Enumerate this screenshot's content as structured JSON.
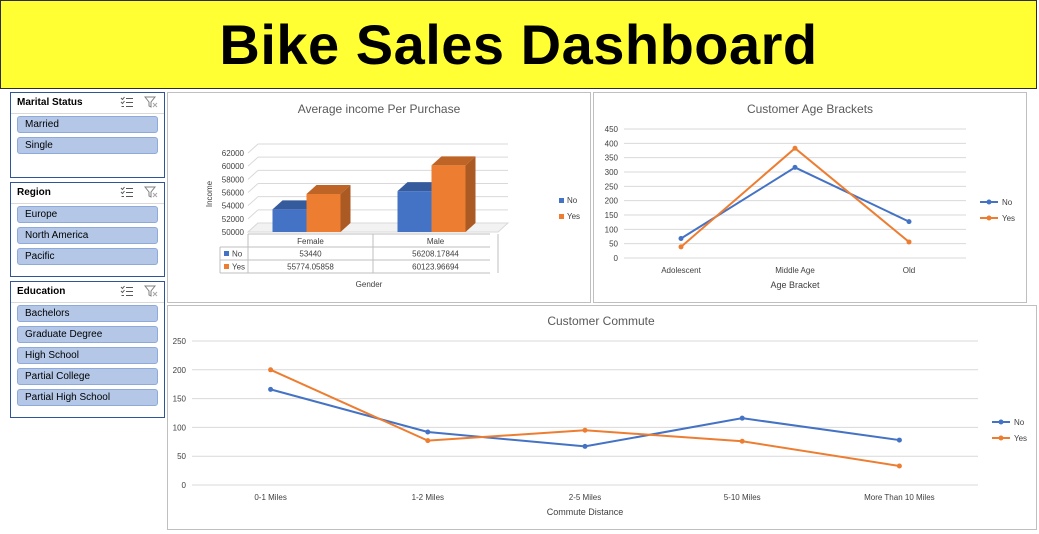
{
  "header": {
    "title": "Bike Sales Dashboard"
  },
  "slicers": [
    {
      "title": "Marital Status",
      "items": [
        "Married",
        "Single"
      ]
    },
    {
      "title": "Region",
      "items": [
        "Europe",
        "North America",
        "Pacific"
      ]
    },
    {
      "title": "Education",
      "items": [
        "Bachelors",
        "Graduate Degree",
        "High School",
        "Partial College",
        "Partial High School"
      ]
    }
  ],
  "colors": {
    "no": "#4472c4",
    "yes": "#ed7d31",
    "banner": "#ffff33",
    "slicer_fill": "#b4c7e7"
  },
  "icons": [
    "multi-select-icon",
    "clear-filter-icon"
  ],
  "chart_data": [
    {
      "type": "bar",
      "title": "Average income Per Purchase",
      "xlabel": "Gender",
      "ylabel": "Income",
      "categories": [
        "Female",
        "Male"
      ],
      "ylim": [
        50000,
        62000
      ],
      "yticks": [
        50000,
        52000,
        54000,
        56000,
        58000,
        60000,
        62000
      ],
      "series": [
        {
          "name": "No",
          "values": [
            53440,
            56208.17844
          ],
          "labels": [
            "53440",
            "56208.17844"
          ]
        },
        {
          "name": "Yes",
          "values": [
            55774.05858,
            60123.96694
          ],
          "labels": [
            "55774.05858",
            "60123.96694"
          ]
        }
      ],
      "legend": "right",
      "data_table": true
    },
    {
      "type": "line",
      "title": "Customer Age Brackets",
      "xlabel": "Age Bracket",
      "ylabel": "",
      "categories": [
        "Adolescent",
        "Middle Age",
        "Old"
      ],
      "ylim": [
        0,
        450
      ],
      "yticks": [
        0,
        50,
        100,
        150,
        200,
        250,
        300,
        350,
        400,
        450
      ],
      "series": [
        {
          "name": "No",
          "values": [
            68,
            316,
            127
          ]
        },
        {
          "name": "Yes",
          "values": [
            39,
            383,
            56
          ]
        }
      ],
      "legend": "right",
      "grid": true
    },
    {
      "type": "line",
      "title": "Customer Commute",
      "xlabel": "Commute Distance",
      "ylabel": "",
      "categories": [
        "0-1 Miles",
        "1-2 Miles",
        "2-5 Miles",
        "5-10 Miles",
        "More Than 10 Miles"
      ],
      "ylim": [
        0,
        250
      ],
      "yticks": [
        0,
        50,
        100,
        150,
        200,
        250
      ],
      "series": [
        {
          "name": "No",
          "values": [
            166,
            92,
            67,
            116,
            78
          ]
        },
        {
          "name": "Yes",
          "values": [
            200,
            77,
            95,
            76,
            33
          ]
        }
      ],
      "legend": "right",
      "grid": true
    }
  ]
}
